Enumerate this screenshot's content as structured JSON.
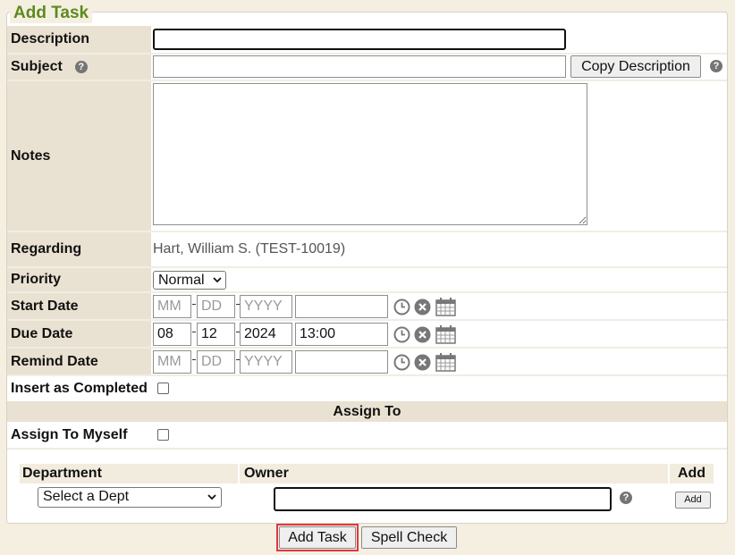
{
  "form": {
    "legend": "Add Task",
    "description_label": "Description",
    "description_value": "",
    "subject_label": "Subject",
    "subject_value": "",
    "copy_description_label": "Copy Description",
    "notes_label": "Notes",
    "notes_value": "",
    "regarding_label": "Regarding",
    "regarding_value": "Hart, William S. (TEST-10019)",
    "priority_label": "Priority",
    "priority_value": "Normal",
    "start_date_label": "Start Date",
    "due_date_label": "Due Date",
    "remind_date_label": "Remind Date",
    "date_placeholders": {
      "month": "MM",
      "day": "DD",
      "year": "YYYY"
    },
    "start_date": {
      "month": "",
      "day": "",
      "year": "",
      "time": ""
    },
    "due_date": {
      "month": "08",
      "day": "12",
      "year": "2024",
      "time": "13:00"
    },
    "remind_date": {
      "month": "",
      "day": "",
      "year": "",
      "time": ""
    },
    "insert_completed_label": "Insert as Completed",
    "assign_to_header": "Assign To",
    "assign_myself_label": "Assign To Myself",
    "department_header": "Department",
    "owner_header": "Owner",
    "add_header": "Add",
    "department_value": "Select a Dept",
    "owner_value": "",
    "add_small_label": "Add"
  },
  "buttons": {
    "add_task_label": "Add Task",
    "spell_check_label": "Spell Check"
  },
  "colors": {
    "page_bg": "#f5efe2",
    "label_bg": "#e9e2d2",
    "legend_green": "#5e8a1e",
    "highlight_red": "#e0393e"
  },
  "icons": [
    "help-icon",
    "clock-icon",
    "clear-icon",
    "calendar-icon",
    "dropdown-chevron-icon"
  ]
}
